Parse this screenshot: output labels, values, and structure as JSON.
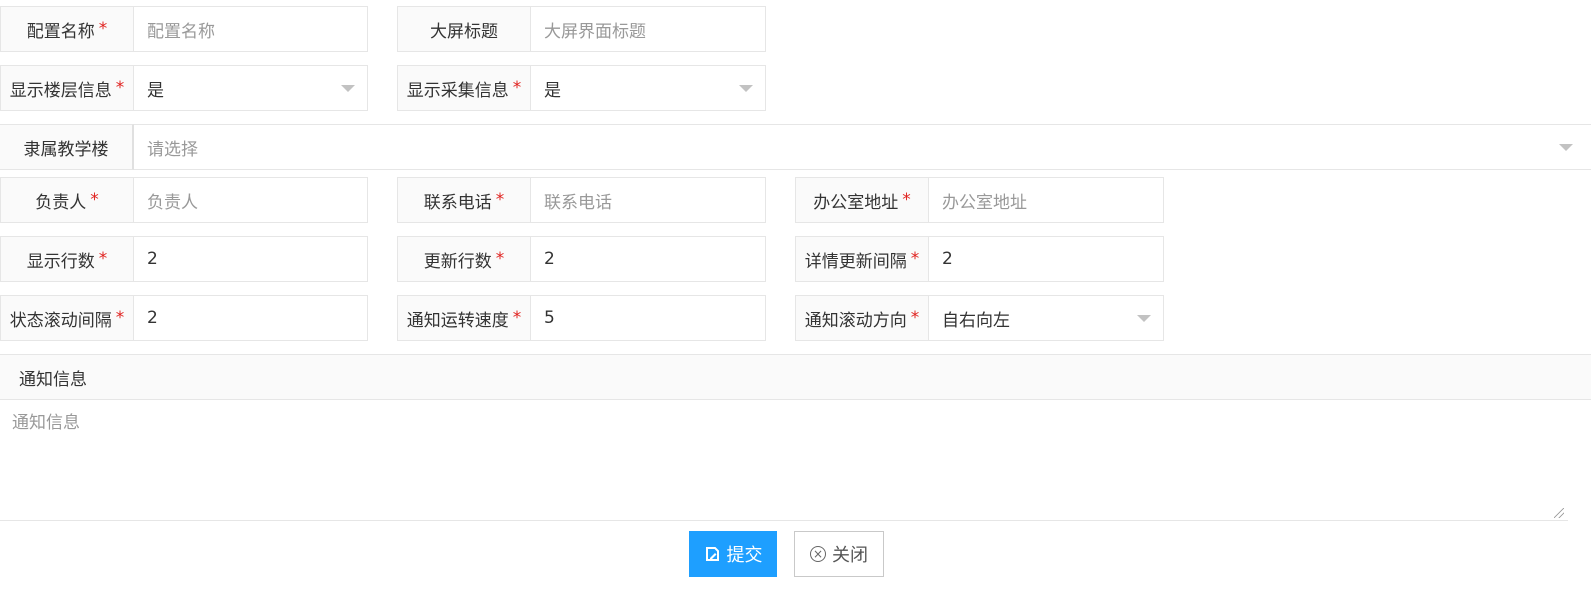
{
  "form": {
    "config_name": {
      "label": "配置名称",
      "required": "*",
      "placeholder": "配置名称"
    },
    "screen_title": {
      "label": "大屏标题",
      "required": "",
      "placeholder": "大屏界面标题"
    },
    "show_floor": {
      "label": "显示楼层信息",
      "required": "*",
      "value": "是"
    },
    "show_collect": {
      "label": "显示采集信息",
      "required": "*",
      "value": "是"
    },
    "building": {
      "label": "隶属教学楼",
      "required": "",
      "placeholder": "请选择"
    },
    "manager": {
      "label": "负责人",
      "required": "*",
      "placeholder": "负责人"
    },
    "phone": {
      "label": "联系电话",
      "required": "*",
      "placeholder": "联系电话"
    },
    "office": {
      "label": "办公室地址",
      "required": "*",
      "placeholder": "办公室地址"
    },
    "rows_shown": {
      "label": "显示行数",
      "required": "*",
      "value": "2"
    },
    "rows_update": {
      "label": "更新行数",
      "required": "*",
      "value": "2"
    },
    "detail_interval": {
      "label": "详情更新间隔",
      "required": "*",
      "value": "2"
    },
    "status_interval": {
      "label": "状态滚动间隔",
      "required": "*",
      "value": "2"
    },
    "notice_speed": {
      "label": "通知运转速度",
      "required": "*",
      "value": "5"
    },
    "notice_direction": {
      "label": "通知滚动方向",
      "required": "*",
      "value": "自右向左"
    },
    "notice": {
      "label": "通知信息",
      "placeholder": "通知信息"
    }
  },
  "buttons": {
    "submit": "提交",
    "close": "关闭"
  },
  "colors": {
    "primary": "#1e9fff",
    "required": "#e0221f"
  },
  "icons": {
    "submit": "edit-icon",
    "close": "close-circle-icon"
  }
}
